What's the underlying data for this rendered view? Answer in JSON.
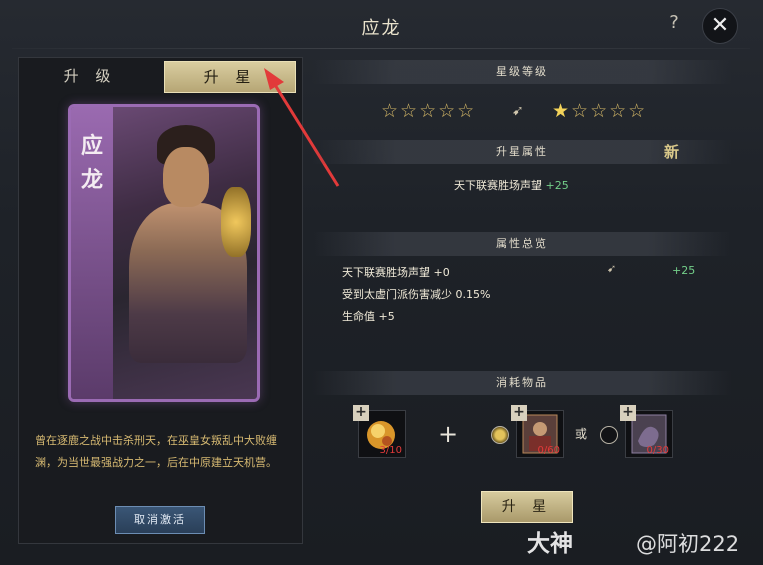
{
  "window": {
    "title": "应龙",
    "help_glyph": "?",
    "close_glyph": "✕"
  },
  "tabs": [
    {
      "label": "升 级",
      "active": false
    },
    {
      "label": "升 星",
      "active": true
    }
  ],
  "card": {
    "name_line1": "应",
    "name_line2": "龙",
    "frame_color": "#9b6bb4"
  },
  "bio": "曾在逐鹿之战中击杀刑天，在巫皇女叛乱中大败缠渊，为当世最强战力之一，后在中原建立天机营。",
  "cancel_button": "取消激活",
  "star_level": {
    "header": "星级等级",
    "current_stars": "☆☆☆☆☆",
    "next_filled": "★",
    "next_empty": "☆☆☆☆",
    "transition_glyph": "➹"
  },
  "upgrade_attrs": {
    "header": "升星属性",
    "new_badge": "新",
    "attr_name": "天下联赛胜场声望",
    "attr_value": "+25"
  },
  "attr_overview": {
    "header": "属性总览",
    "rows": [
      {
        "text": "天下联赛胜场声望 +0",
        "arrow": "➹",
        "plus": "+25"
      },
      {
        "text": "受到太虚门派伤害减少 0.15%"
      },
      {
        "text": "生命值 +5"
      }
    ]
  },
  "consumables": {
    "header": "消耗物品",
    "items": [
      {
        "name": "gold-orb-item",
        "count": "3/10"
      },
      {
        "name": "hero-card-item",
        "count": "0/60"
      },
      {
        "name": "dragon-card-item",
        "count": "0/30"
      }
    ],
    "plus_sign": "+",
    "or_text": "或"
  },
  "upgrade_button": "升 星",
  "watermark": {
    "brand": "大神",
    "user": "@阿初222"
  }
}
